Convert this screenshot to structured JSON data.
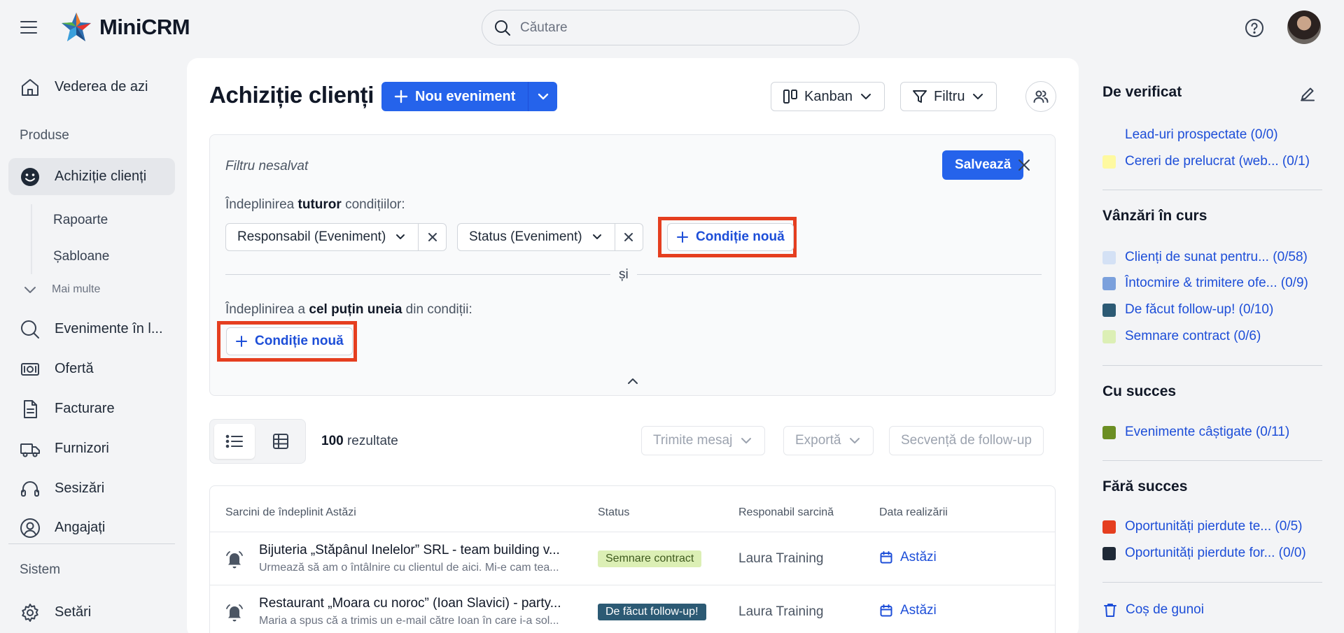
{
  "app": {
    "name": "MiniCRM"
  },
  "search": {
    "placeholder": "Căutare"
  },
  "sidebar": {
    "items": [
      {
        "label": "Vederea de azi"
      },
      {
        "label": "Achiziție clienți"
      },
      {
        "label": "Evenimente în l..."
      },
      {
        "label": "Ofertă"
      },
      {
        "label": "Facturare"
      },
      {
        "label": "Furnizori"
      },
      {
        "label": "Sesizări"
      },
      {
        "label": "Angajați"
      },
      {
        "label": "Setări"
      }
    ],
    "sections": {
      "products": "Produse",
      "system": "Sistem"
    },
    "sub_items": [
      "Rapoarte",
      "Șabloane"
    ],
    "more": "Mai multe"
  },
  "main": {
    "title": "Achiziție clienți",
    "new_event": "Nou eveniment",
    "kanban": "Kanban",
    "filter": "Filtru"
  },
  "filter_panel": {
    "name": "Filtru nesalvat",
    "save": "Salvează",
    "all_prefix": "Îndeplinirea ",
    "all_bold": "tuturor",
    "all_suffix": " condițiilor:",
    "chips": [
      "Responsabil (Eveniment)",
      "Status (Eveniment)"
    ],
    "new_condition": "Condiție nouă",
    "and": "și",
    "any_prefix": "Îndeplinirea a ",
    "any_bold": "cel puțin uneia",
    "any_suffix": " din condiții:"
  },
  "results": {
    "count": "100",
    "label": " rezultate",
    "send_message": "Trimite mesaj",
    "export": "Exportă",
    "followup": "Secvență de follow-up"
  },
  "table": {
    "headers": [
      "Sarcini de îndeplinit Astăzi",
      "Status",
      "Responabil sarcină",
      "Data realizării"
    ],
    "rows": [
      {
        "title": "Bijuteria „Stăpânul Inelelor” SRL - team building v...",
        "desc": "Urmează să am o întâlnire cu clientul de aici. Mi-e cam tea...",
        "status": "Semnare contract",
        "responsible": "Laura Training",
        "date": "Astăzi"
      },
      {
        "title": "Restaurant „Moara cu noroc” (Ioan Slavici) - party...",
        "desc": "Maria a spus că a trimis un e-mail către Ioan în care i-a sol...",
        "status": "De făcut follow-up!",
        "responsible": "Laura Training",
        "date": "Astăzi"
      }
    ]
  },
  "right_panel": {
    "sections": [
      {
        "title": "De verificat",
        "items": [
          {
            "label": "Lead-uri prospectate (0/0)",
            "color": "#f3f4f6"
          },
          {
            "label": "Cereri de prelucrat (web... (0/1)",
            "color": "#fef9a0"
          }
        ]
      },
      {
        "title": "Vânzări în curs",
        "items": [
          {
            "label": "Clienți de sunat pentru...  (0/58)",
            "color": "#d4e1f5"
          },
          {
            "label": "Întocmire & trimitere ofe... (0/9)",
            "color": "#7ba0dc"
          },
          {
            "label": "De făcut follow-up! (0/10)",
            "color": "#2c5a74"
          },
          {
            "label": "Semnare contract (0/6)",
            "color": "#dcefb5"
          }
        ]
      },
      {
        "title": "Cu succes",
        "items": [
          {
            "label": "Evenimente câștigate (0/11)",
            "color": "#6b8e23"
          }
        ]
      },
      {
        "title": "Fără succes",
        "items": [
          {
            "label": "Oportunități pierdute te... (0/5)",
            "color": "#e53e1f"
          },
          {
            "label": "Oportunități pierdute for... (0/0)",
            "color": "#1f2937"
          }
        ]
      }
    ],
    "trash": "Coș de gunoi"
  },
  "colors": {
    "accent": "#2563eb",
    "highlight": "#e53e1f",
    "badge_contract_bg": "#dcefb5",
    "badge_followup_bg": "#2c5a74"
  }
}
